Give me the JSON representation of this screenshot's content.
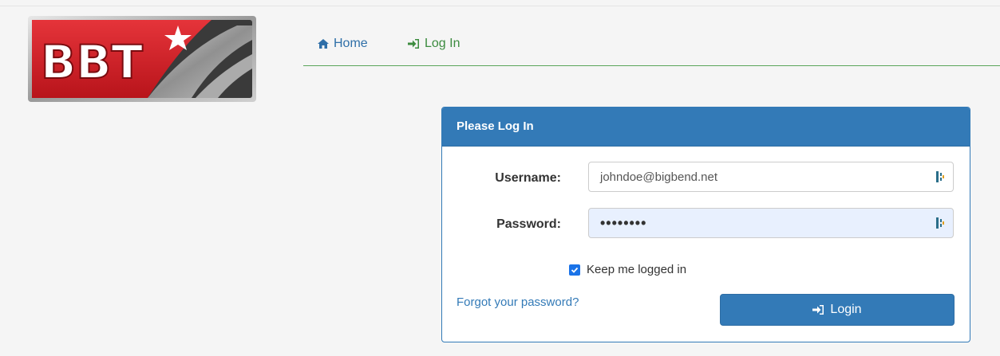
{
  "brand": {
    "logo_text": "BBT",
    "colors": {
      "red": "#d8232a",
      "silver": "#a9a9a9",
      "dark": "#2b2b2b"
    }
  },
  "nav": {
    "items": [
      {
        "label": "Home",
        "icon": "home-icon"
      },
      {
        "label": "Log In",
        "icon": "sign-in-icon"
      }
    ],
    "accent": "#3d8c40"
  },
  "panel": {
    "title": "Please Log In",
    "accent": "#337ab7"
  },
  "form": {
    "username_label": "Username:",
    "username_value": "johndoe@bigbend.net",
    "password_label": "Password:",
    "password_value": "••••••••",
    "keep_logged_in_label": "Keep me logged in",
    "keep_logged_in_checked": true,
    "forgot_label": "Forgot your password?",
    "login_label": "Login"
  }
}
